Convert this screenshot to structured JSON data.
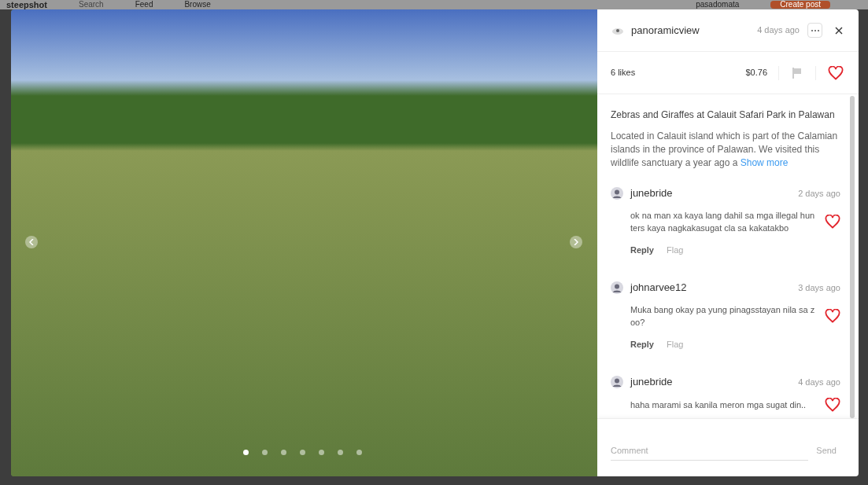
{
  "header": {
    "logo": "steepshot",
    "search_placeholder": "Search",
    "nav": [
      {
        "label": "Feed"
      },
      {
        "label": "Browse"
      }
    ],
    "user": "pasadomata",
    "create_button": "Create post"
  },
  "post": {
    "author": "panoramicview",
    "time": "4 days ago",
    "likes": "6 likes",
    "payout": "$0.76",
    "title": "Zebras and Giraffes at Calauit Safari Park in Palawan",
    "description": "Located in Calauit island which is part of the Calamian islands in the province of Palawan. We visited this wildlife sanctuary a year ago a",
    "show_more": "Show more",
    "slides": [
      {
        "selected": true
      },
      {
        "selected": false
      },
      {
        "selected": false
      },
      {
        "selected": false
      },
      {
        "selected": false
      },
      {
        "selected": false
      },
      {
        "selected": false
      }
    ]
  },
  "comments": [
    {
      "author": "junebride",
      "time": "2 days ago",
      "text": "ok na man xa kaya lang dahil sa mga illegal hun ters kaya nagkakasugat cla sa kakatakbo",
      "reply": "Reply",
      "flag": "Flag"
    },
    {
      "author": "johnarvee12",
      "time": "3 days ago",
      "text": "Muka bang okay pa yung pinagsstayan nila sa z oo?",
      "reply": "Reply",
      "flag": "Flag"
    },
    {
      "author": "junebride",
      "time": "4 days ago",
      "text": "haha marami sa kanila meron mga sugat din.."
    }
  ],
  "comment_box": {
    "placeholder": "Comment",
    "send": "Send"
  }
}
